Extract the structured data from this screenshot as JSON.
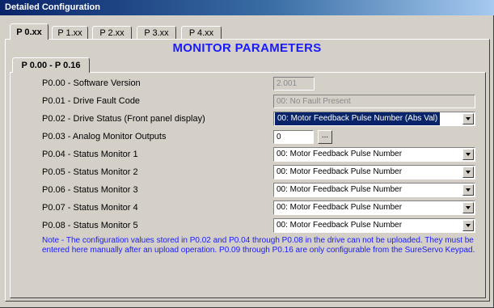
{
  "window": {
    "title": "Detailed Configuration"
  },
  "tabs": [
    {
      "label": "P 0.xx",
      "active": true
    },
    {
      "label": "P 1.xx",
      "active": false
    },
    {
      "label": "P 2.xx",
      "active": false
    },
    {
      "label": "P 3.xx",
      "active": false
    },
    {
      "label": "P 4.xx",
      "active": false
    }
  ],
  "section_title": "MONITOR PARAMETERS",
  "inner_tab": {
    "label": "P 0.00 - P 0.16"
  },
  "params": {
    "p000": {
      "label": "P0.00 - Software Version",
      "value": "2.001"
    },
    "p001": {
      "label": "P0.01 - Drive Fault Code",
      "value": "00: No Fault Present"
    },
    "p002": {
      "label": "P0.02 - Drive Status (Front panel display)",
      "value": "00: Motor Feedback Pulse Number (Abs Val)"
    },
    "p003": {
      "label": "P0.03 - Analog Monitor Outputs",
      "value": "0",
      "button": "..."
    },
    "p004": {
      "label": "P0.04 - Status Monitor 1",
      "value": "00: Motor Feedback Pulse Number"
    },
    "p005": {
      "label": "P0.05 - Status Monitor 2",
      "value": "00: Motor Feedback Pulse Number"
    },
    "p006": {
      "label": "P0.06 - Status Monitor 3",
      "value": "00: Motor Feedback Pulse Number"
    },
    "p007": {
      "label": "P0.07 - Status Monitor 4",
      "value": "00: Motor Feedback Pulse Number"
    },
    "p008": {
      "label": "P0.08 - Status Monitor 5",
      "value": "00: Motor Feedback Pulse Number"
    }
  },
  "note": "Note - The configuration values stored in P0.02 and P0.04 through P0.08 in the drive can not be uploaded. They must be entered here manually after an upload operation. P0.09 through P0.16 are only configurable from the SureServo Keypad.",
  "colors": {
    "accent": "#1a1aff",
    "titlebar": "#0a246a",
    "background": "#d4d0c8"
  }
}
